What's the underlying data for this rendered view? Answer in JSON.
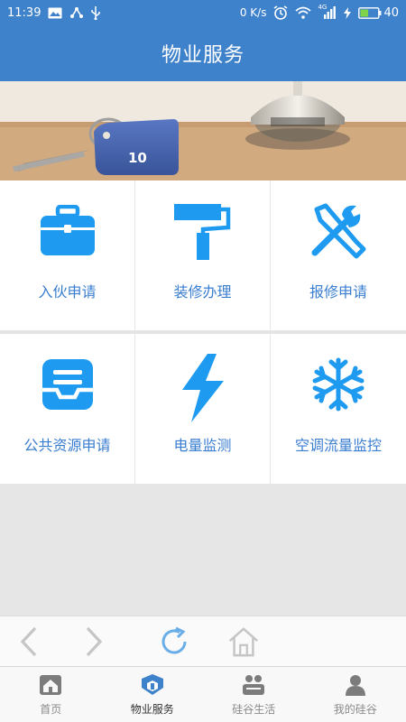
{
  "status_bar": {
    "time": "11:39",
    "speed": "0 K/s",
    "battery": "40",
    "network": "4G"
  },
  "header": {
    "title": "物业服务"
  },
  "banner": {
    "key_tag_number": "10"
  },
  "services": [
    {
      "label": "入伙申请",
      "icon": "briefcase-icon"
    },
    {
      "label": "装修办理",
      "icon": "paint-roller-icon"
    },
    {
      "label": "报修申请",
      "icon": "tools-icon"
    },
    {
      "label": "公共资源申请",
      "icon": "inbox-tray-icon"
    },
    {
      "label": "电量监测",
      "icon": "lightning-icon"
    },
    {
      "label": "空调流量监控",
      "icon": "snowflake-icon"
    }
  ],
  "browser_controls": {
    "icons": [
      "back-arrow-icon",
      "forward-arrow-icon",
      "refresh-icon",
      "home-icon"
    ]
  },
  "tabs": [
    {
      "label": "首页",
      "icon": "home-tab-icon",
      "active": false
    },
    {
      "label": "物业服务",
      "icon": "property-service-icon",
      "active": true
    },
    {
      "label": "硅谷生活",
      "icon": "life-icon",
      "active": false
    },
    {
      "label": "我的硅谷",
      "icon": "user-icon",
      "active": false
    }
  ],
  "colors": {
    "primary": "#3f82cc",
    "icon_blue": "#1e9af0",
    "label_blue": "#3a7ed0",
    "background": "#e6e6e6"
  }
}
